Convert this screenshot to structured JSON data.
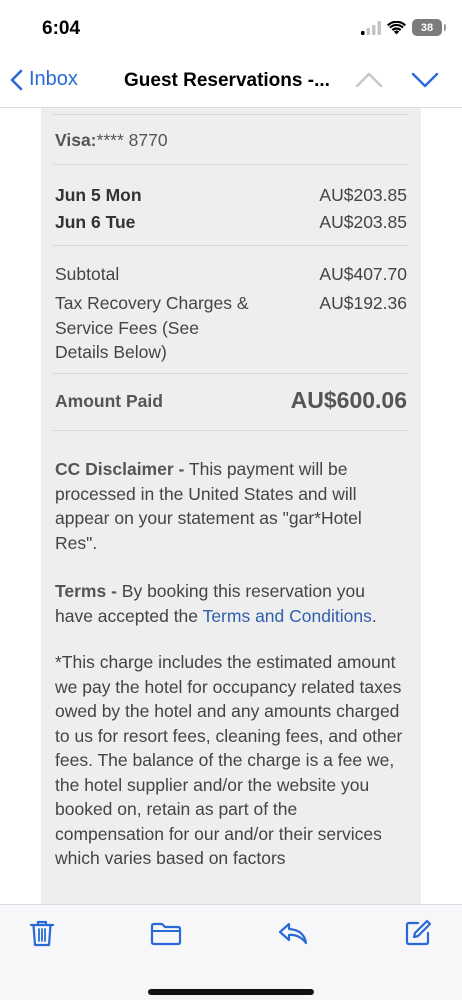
{
  "status_bar": {
    "time": "6:04",
    "battery": "38",
    "icons": [
      "signal-icon",
      "wifi-icon",
      "battery-icon"
    ]
  },
  "nav": {
    "back_label": "Inbox",
    "title": "Guest Reservations -...",
    "accent": "#2a6ad8"
  },
  "receipt": {
    "card_label": "Visa:",
    "card_number": "**** 8770",
    "nights": [
      {
        "date": "Jun 5 Mon",
        "amount": "AU$203.85"
      },
      {
        "date": "Jun 6 Tue",
        "amount": "AU$203.85"
      }
    ],
    "subtotal_label": "Subtotal",
    "subtotal_amount": "AU$407.70",
    "tax_label_lines": [
      "Tax Recovery Charges &",
      "Service Fees (See",
      "Details Below)"
    ],
    "tax_amount": "AU$192.36",
    "amount_paid_label": "Amount Paid",
    "amount_paid_value": "AU$600.06"
  },
  "disclaimer": {
    "head": "CC Disclaimer -",
    "text": " This payment will be processed in the United States and will appear on your statement as \"gar*Hotel Res\"."
  },
  "terms": {
    "head": "Terms -",
    "text": " By booking this reservation you have accepted the ",
    "link": "Terms and Conditions",
    "end": "."
  },
  "charge_note": "*This charge includes the estimated amount we pay the hotel for occupancy related taxes owed by the hotel and any amounts charged to us for resort fees, cleaning fees, and other fees. The balance of the charge is a fee we, the hotel supplier and/or the website you booked on, retain as part of the compensation for our and/or their services which varies based on factors",
  "toolbar": {
    "buttons": [
      "trash-icon",
      "folder-icon",
      "reply-icon",
      "compose-icon"
    ]
  }
}
